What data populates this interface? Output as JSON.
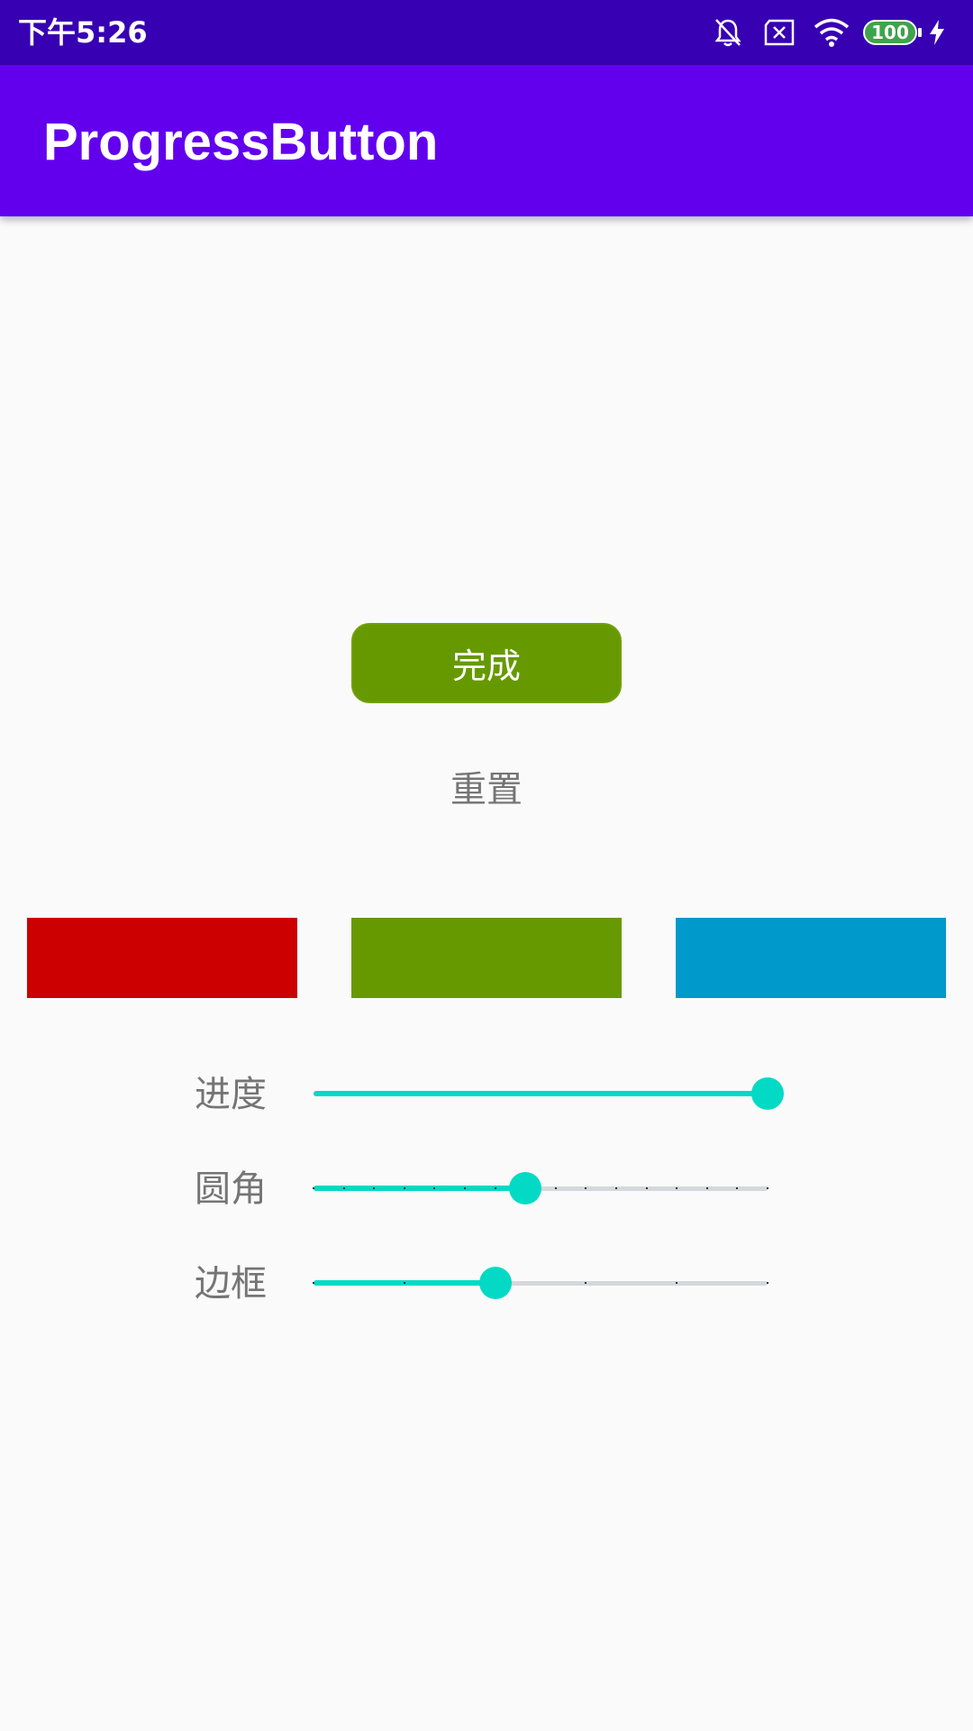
{
  "status_bar": {
    "time": "下午5:26",
    "battery_level": "100",
    "icons": [
      "bell-off-icon",
      "sim-x-icon",
      "wifi-icon",
      "battery-icon",
      "charging-icon"
    ]
  },
  "app_bar": {
    "title": "ProgressButton"
  },
  "progress_button": {
    "label": "完成",
    "color": "#669900"
  },
  "reset_button": {
    "label": "重置"
  },
  "color_swatches": [
    {
      "name": "red",
      "color": "#CC0000"
    },
    {
      "name": "green",
      "color": "#669900"
    },
    {
      "name": "blue",
      "color": "#0099CC"
    }
  ],
  "settings": [
    {
      "label": "进度",
      "value_fraction": 1.0,
      "discrete": false,
      "steps": 0
    },
    {
      "label": "圆角",
      "value_fraction": 0.466,
      "discrete": true,
      "steps": 15
    },
    {
      "label": "边框",
      "value_fraction": 0.4,
      "discrete": true,
      "steps": 5
    }
  ],
  "colors": {
    "status_bar": "#3700B3",
    "app_bar": "#6200EE",
    "slider_accent": "#03DAC5",
    "slider_track": "#D6D7DA",
    "background": "#FAFAFA",
    "label_text": "#757575"
  }
}
